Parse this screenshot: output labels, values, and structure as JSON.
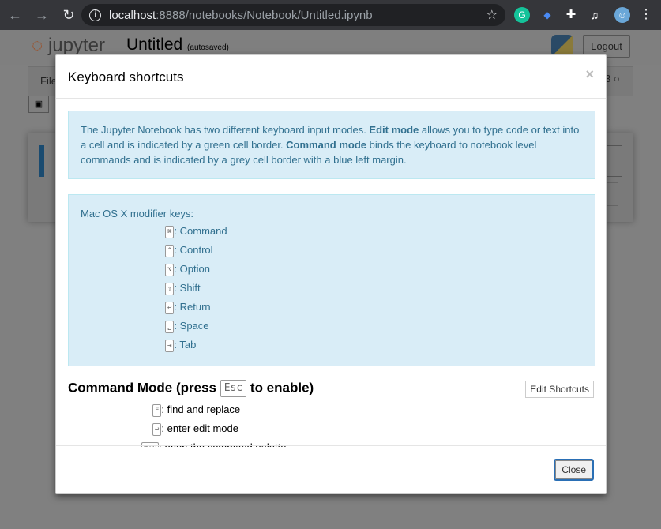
{
  "browser": {
    "url_host": "localhost",
    "url_rest": ":8888/notebooks/Notebook/Untitled.ipynb"
  },
  "notebook": {
    "logo": "jupyter",
    "title": "Untitled",
    "status": "(autosaved)",
    "logout": "Logout",
    "menu_first": "File",
    "kernel_partial": "3"
  },
  "modal": {
    "title": "Keyboard shortcuts",
    "close_x": "×",
    "intro": {
      "p1": "The Jupyter Notebook has two different keyboard input modes. ",
      "b1": "Edit mode",
      "p2": " allows you to type code or text into a cell and is indicated by a green cell border. ",
      "b2": "Command mode",
      "p3": " binds the keyboard to notebook level commands and is indicated by a grey cell border with a blue left margin."
    },
    "mac_heading": "Mac OS X modifier keys:",
    "modifiers": [
      {
        "key": "⌘",
        "label": ": Command"
      },
      {
        "key": "^",
        "label": ": Control"
      },
      {
        "key": "⌥",
        "label": ": Option"
      },
      {
        "key": "⇧",
        "label": ": Shift"
      },
      {
        "key": "↩",
        "label": ": Return"
      },
      {
        "key": "␣",
        "label": ": Space"
      },
      {
        "key": "⇥",
        "label": ": Tab"
      }
    ],
    "command_heading_pre": "Command Mode (press ",
    "command_heading_key": "Esc",
    "command_heading_post": " to enable)",
    "edit_shortcuts": "Edit Shortcuts",
    "shortcuts": [
      {
        "key": "F",
        "label": ": find and replace"
      },
      {
        "key": "↩",
        "label": ": enter edit mode"
      },
      {
        "key": "⌘⇧P",
        "label": ": open the command palette"
      }
    ],
    "close": "Close"
  }
}
